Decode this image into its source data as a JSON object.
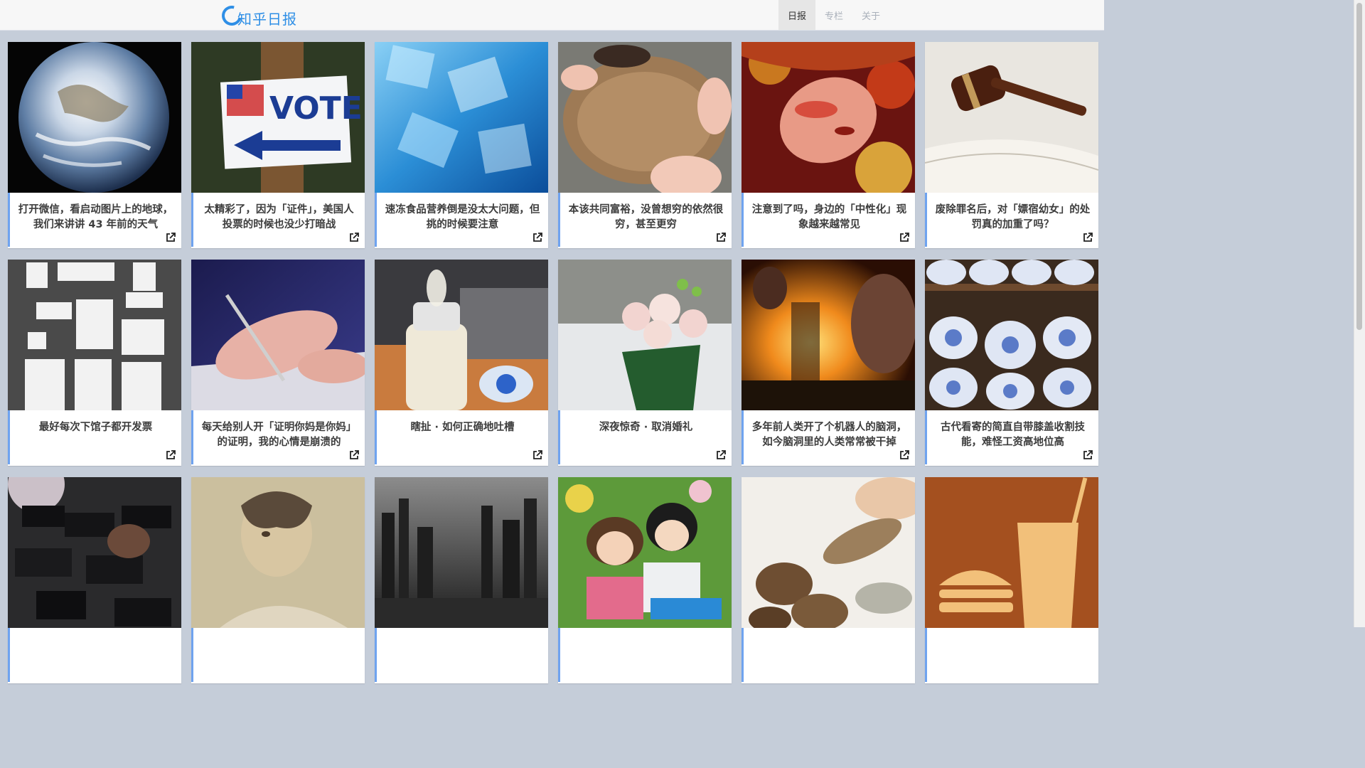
{
  "header": {
    "logo_text": "知乎日报",
    "nav": [
      {
        "label": "日报",
        "active": true
      },
      {
        "label": "专栏",
        "active": false
      },
      {
        "label": "关于",
        "active": false
      }
    ]
  },
  "colors": {
    "accent": "#2f8fe6",
    "card_border": "#6fa3ef",
    "page_bg": "#c5cdd9"
  },
  "cards": [
    {
      "title": "打开微信，看启动图片上的地球，我们来讲讲 43 年前的天气",
      "image": "earth"
    },
    {
      "title": "太精彩了，因为「证件」，美国人投票的时候也没少打暗战",
      "image": "vote-sign"
    },
    {
      "title": "速冻食品营养倒是没太大问题，但挑的时候要注意",
      "image": "ice-cubes"
    },
    {
      "title": "本该共同富裕，没曾想穷的依然很穷，甚至更穷",
      "image": "empty-bowl"
    },
    {
      "title": "注意到了吗，身边的「中性化」现象越来越常见",
      "image": "opera-face"
    },
    {
      "title": "废除罪名后，对「嫖宿幼女」的处罚真的加重了吗？",
      "image": "gavel-book"
    },
    {
      "title": "最好每次下馆子都开发票",
      "image": "receipts"
    },
    {
      "title": "每天给别人开「证明你妈是你妈」的证明，我的心情是崩溃的",
      "image": "writing-hand"
    },
    {
      "title": "瞎扯 · 如何正确地吐槽",
      "image": "baby-bottle"
    },
    {
      "title": "深夜惊奇 · 取消婚礼",
      "image": "flowers"
    },
    {
      "title": "多年前人类开了个机器人的脑洞，如今脑洞里的人类常常被干掉",
      "image": "terminator"
    },
    {
      "title": "古代看寄的简直自带膝盖收割技能，难怪工资高地位高",
      "image": "porcelain"
    },
    {
      "title": "",
      "image": "press-cameras"
    },
    {
      "title": "",
      "image": "portrait-sketch"
    },
    {
      "title": "",
      "image": "ruined-city"
    },
    {
      "title": "",
      "image": "anime-kids"
    },
    {
      "title": "",
      "image": "dried-food"
    },
    {
      "title": "",
      "image": "fast-food-icon"
    }
  ]
}
